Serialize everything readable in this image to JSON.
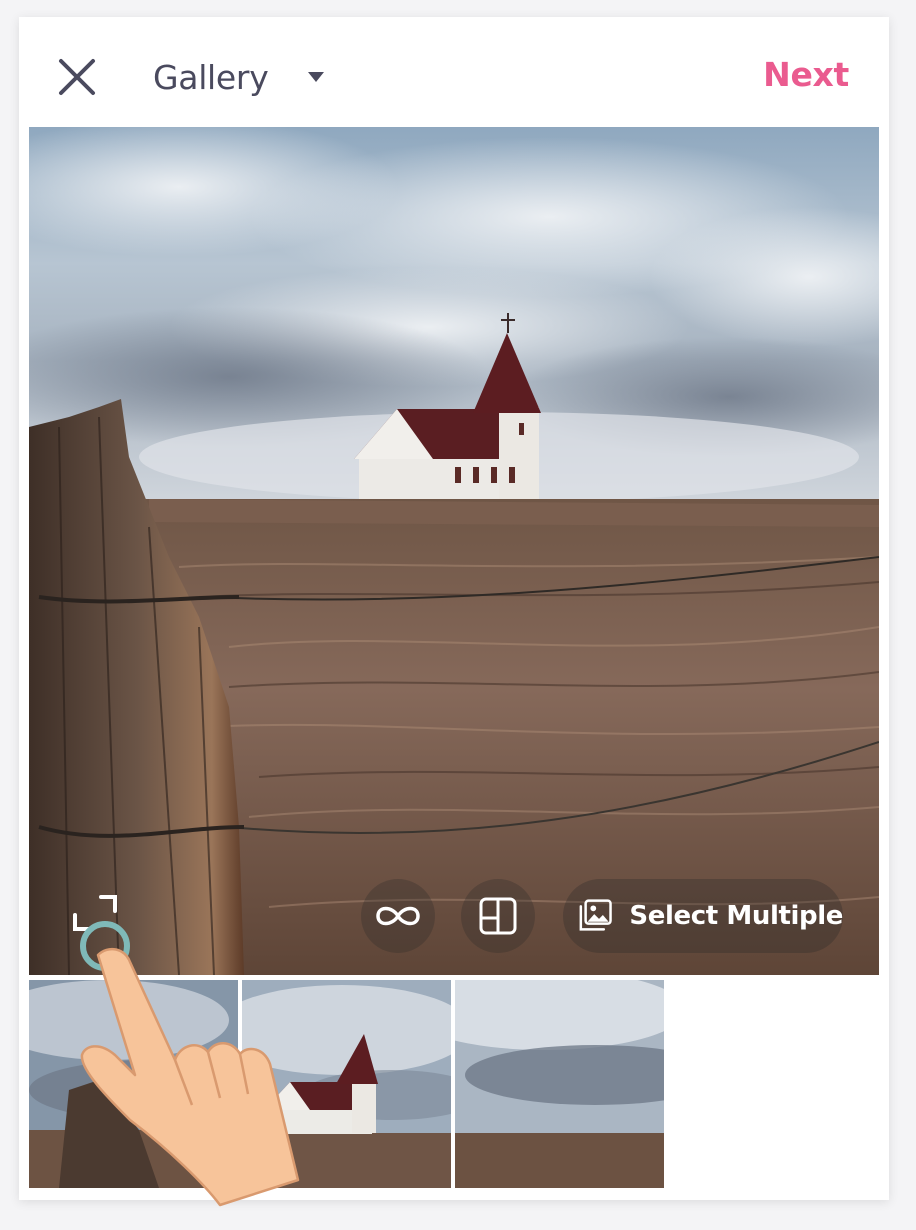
{
  "header": {
    "close_icon": "close-icon",
    "title": "Gallery",
    "dropdown_icon": "caret-down-icon",
    "next_label": "Next"
  },
  "toolbar": {
    "expand_icon": "expand-corners-icon",
    "boomerang_icon": "infinity-icon",
    "layout_icon": "layout-grid-icon",
    "select_multiple_icon": "stacked-images-icon",
    "select_multiple_label": "Select Multiple"
  },
  "thumbnails": [
    {
      "subject": "fence post and field"
    },
    {
      "subject": "church on hill"
    },
    {
      "subject": "field and cloudy sky"
    }
  ],
  "overlay": {
    "pointer_icon": "tap-hand-icon"
  },
  "colors": {
    "accent": "#ea5b8f",
    "title_text": "#4a4a5e",
    "icon_dark": "#4a4a5e",
    "tap_ring": "#7fb9b8",
    "hand_skin": "#f7c49a"
  }
}
